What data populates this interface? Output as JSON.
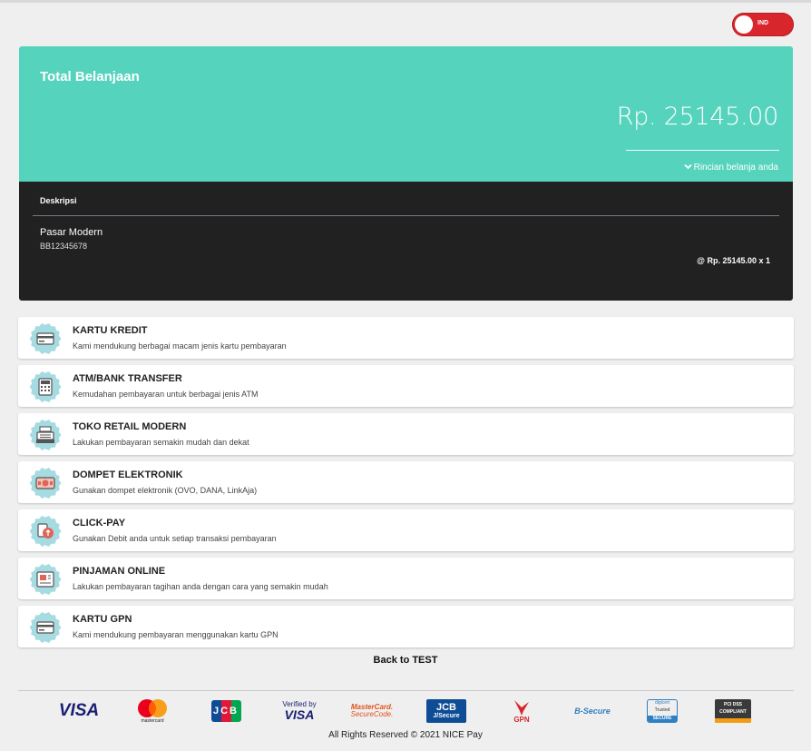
{
  "language": {
    "label": "IND"
  },
  "summary": {
    "title": "Total Belanjaan",
    "amount": "Rp. 25145.00",
    "details_link": "Rincian belanja anda"
  },
  "description": {
    "header": "Deskripsi",
    "item_name": "Pasar Modern",
    "item_code": "BB12345678",
    "item_price": "@ Rp. 25145.00 x 1"
  },
  "methods": [
    {
      "title": "KARTU KREDIT",
      "desc": "Kami mendukung berbagai macam jenis kartu pembayaran",
      "icon": "credit-card-icon"
    },
    {
      "title": "ATM/BANK TRANSFER",
      "desc": "Kemudahan pembayaran untuk berbagai jenis ATM",
      "icon": "atm-icon"
    },
    {
      "title": "TOKO RETAIL MODERN",
      "desc": "Lakukan pembayaran semakin mudah dan dekat",
      "icon": "cash-register-icon"
    },
    {
      "title": "DOMPET ELEKTRONIK",
      "desc": "Gunakan dompet elektronik (OVO, DANA, LinkAja)",
      "icon": "wallet-icon"
    },
    {
      "title": "CLICK-PAY",
      "desc": "Gunakan Debit anda untuk setiap transaksi pembayaran",
      "icon": "click-pay-icon"
    },
    {
      "title": "PINJAMAN ONLINE",
      "desc": "Lakukan pembayaran tagihan anda dengan cara yang semakin mudah",
      "icon": "loan-icon"
    },
    {
      "title": "KARTU GPN",
      "desc": "Kami mendukung pembayaran menggunakan kartu GPN",
      "icon": "gpn-card-icon"
    }
  ],
  "back_link": "Back to TEST",
  "logos": {
    "visa": "VISA",
    "mastercard": "mastercard",
    "jcb": "JCB",
    "verified_visa_top": "Verified by",
    "verified_visa_bottom": "VISA",
    "mc_securecode_top": "MasterCard.",
    "mc_securecode_bottom": "SecureCode.",
    "jsecure_top": "JCB",
    "jsecure_bottom": "J/Secure",
    "gpn": "GPN",
    "bsecure": "B-Secure",
    "digicert_top": "digicert",
    "digicert_mid": "Trusted",
    "digicert_bottom": "SECURE",
    "pci_top": "PCI DSS",
    "pci_bottom": "COMPLIANT"
  },
  "copyright": "All Rights Reserved © 2021 NICE Pay",
  "colors": {
    "accent": "#56d3bd",
    "panel": "#212121",
    "toggle": "#d9262c",
    "badge": "#a6dbe2"
  }
}
